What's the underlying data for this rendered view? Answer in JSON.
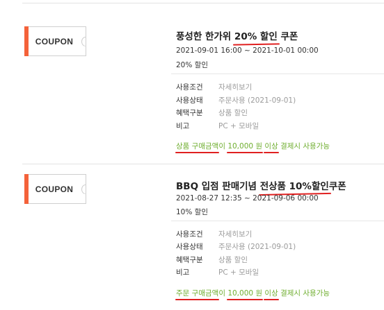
{
  "coupons": [
    {
      "tag": "COUPON",
      "title_pre": "풍성한 한가위 ",
      "title_hl": "20% 할인",
      "title_post": " 쿠폰",
      "period": "2021-09-01 16:00 ~ 2021-10-01 00:00",
      "benefit": "20% 할인",
      "details": [
        {
          "key": "사용조건",
          "value": "자세히보기"
        },
        {
          "key": "사용상태",
          "value": "주문사용 (2021-09-01)"
        },
        {
          "key": "혜택구분",
          "value": "상품 할인"
        },
        {
          "key": "비고",
          "value": "PC + 모바일"
        }
      ],
      "note": {
        "p1": "상품 구매금액",
        "p2": "이 ",
        "p3": "10,000 원",
        "p4": " ",
        "p5": "이상",
        "p6": " 결제시 사용가능"
      }
    },
    {
      "tag": "COUPON",
      "title_pre": "BBQ 입점 판매기념 ",
      "title_hl": "전상품 10%할인",
      "title_post": "쿠폰",
      "period": "2021-08-27 12:35 ~ 2021-09-06 00:00",
      "benefit": "10% 할인",
      "details": [
        {
          "key": "사용조건",
          "value": "자세히보기"
        },
        {
          "key": "사용상태",
          "value": "주문사용 (2021-09-01)"
        },
        {
          "key": "혜택구분",
          "value": "상품 할인"
        },
        {
          "key": "비고",
          "value": "PC + 모바일"
        }
      ],
      "note": {
        "p1": "주문 구매금액",
        "p2": "이 ",
        "p3": "10,000 원",
        "p4": " ",
        "p5": "이상",
        "p6": " 결제시 사용가능"
      }
    }
  ]
}
